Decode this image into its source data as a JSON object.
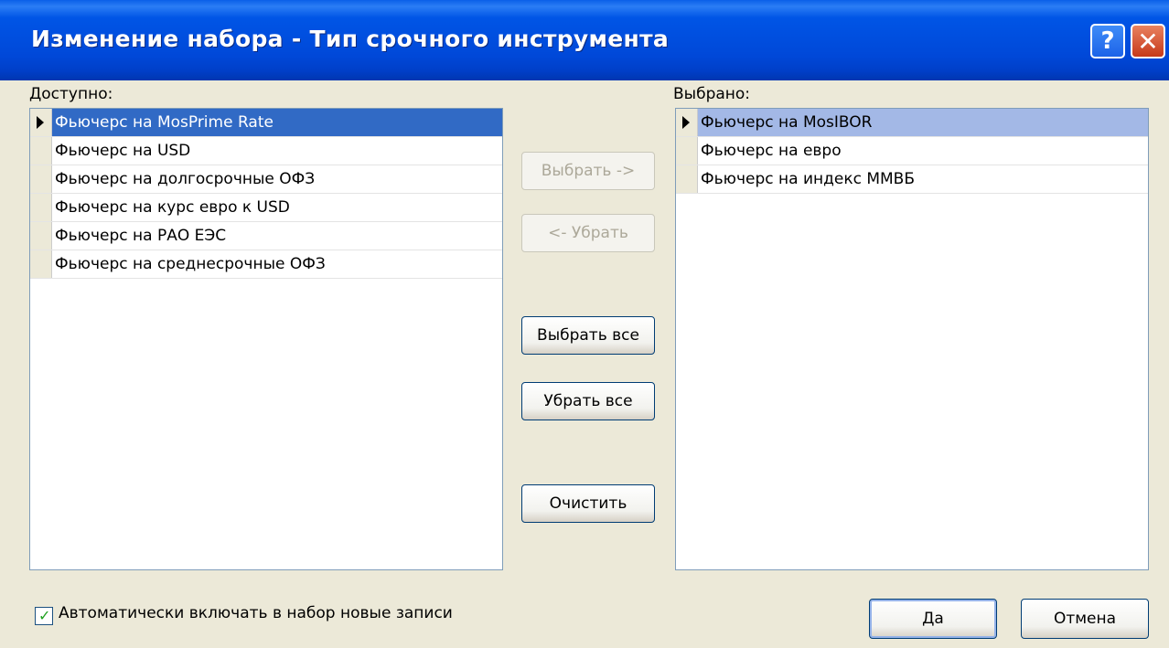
{
  "window": {
    "title": "Изменение набора - Тип срочного инструмента",
    "help_label": "?",
    "close_label": "✕"
  },
  "available": {
    "label": "Доступно:",
    "items": [
      "Фьючерс на MosPrime Rate",
      "Фьючерс на USD",
      "Фьючерс на долгосрочные ОФЗ",
      "Фьючерс на курс евро к USD",
      "Фьючерс на РАО ЕЭС",
      "Фьючерс на среднесрочные ОФЗ"
    ],
    "selected_index": 0
  },
  "selected": {
    "label": "Выбрано:",
    "items": [
      "Фьючерс на MosIBOR",
      "Фьючерс на евро",
      "Фьючерс на индекс ММВБ"
    ],
    "selected_index": 0
  },
  "buttons": {
    "add": "Выбрать ->",
    "remove": "<- Убрать",
    "add_all": "Выбрать все",
    "remove_all": "Убрать все",
    "clear": "Очистить",
    "ok": "Да",
    "cancel": "Отмена"
  },
  "options": {
    "auto_include_label": "Автоматически включать в набор новые записи",
    "auto_include_checked": true
  },
  "colors": {
    "titlebar": "#0055e6",
    "selection_active": "#316ac5",
    "selection_inactive": "#a3b8e6",
    "dialog_bg": "#ece9d8"
  }
}
